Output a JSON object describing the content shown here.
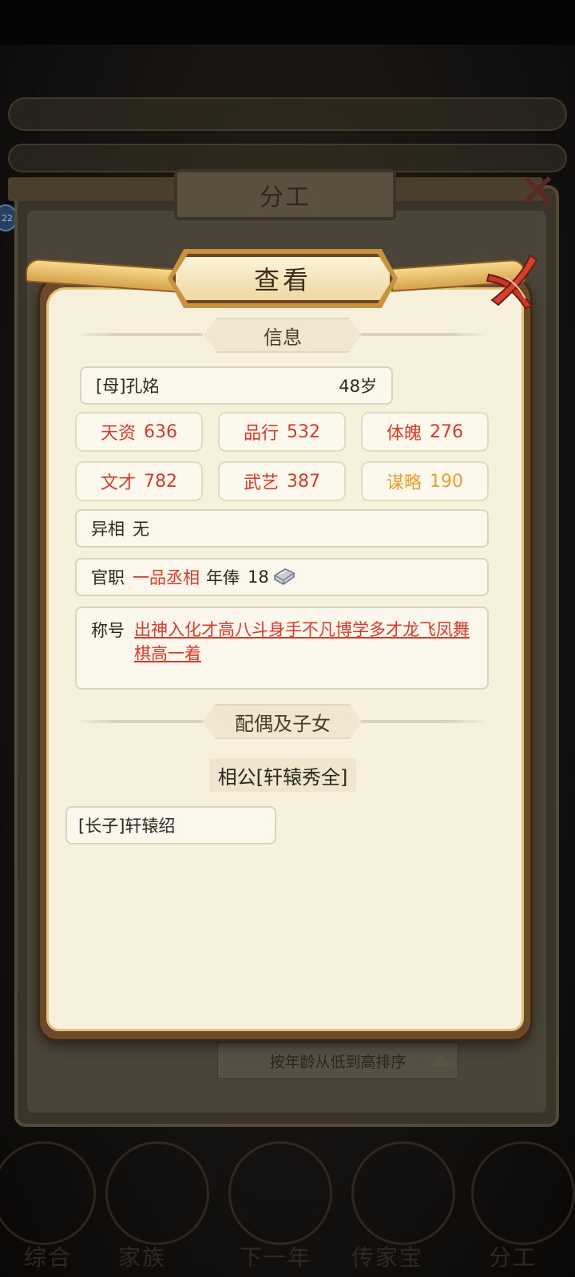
{
  "background": {
    "panel_title": "分工",
    "sort_label": "按年龄从低到高排序",
    "badge": "22",
    "nav_labels": [
      "综合",
      "家族",
      "下一年",
      "传家宝",
      "分工"
    ]
  },
  "dialog": {
    "title": "查看",
    "info_header": "信息",
    "member": {
      "name": "[母]孔姳",
      "age": "48岁"
    },
    "stats": [
      {
        "label": "天资",
        "value": "636",
        "color": "#d43b2a"
      },
      {
        "label": "品行",
        "value": "532",
        "color": "#d43b2a"
      },
      {
        "label": "体魄",
        "value": "276",
        "color": "#d43b2a"
      },
      {
        "label": "文才",
        "value": "782",
        "color": "#d43b2a"
      },
      {
        "label": "武艺",
        "value": "387",
        "color": "#d43b2a"
      },
      {
        "label": "谋略",
        "value": "190",
        "color": "#e8a12a"
      }
    ],
    "trait": {
      "label": "异相",
      "value": "无"
    },
    "office": {
      "label": "官职",
      "value": "一品丞相",
      "salary_label": "年俸",
      "salary_value": "18",
      "salary_icon": "silver-ingot-icon"
    },
    "titles": {
      "label": "称号",
      "items": [
        "出神入化",
        "才高八斗",
        "身手不凡",
        "博学多才",
        "龙飞凤舞",
        "棋高一着"
      ]
    },
    "family_header": "配偶及子女",
    "spouse": "相公[轩辕秀全]",
    "children": [
      "[长子]轩辕绍"
    ]
  }
}
